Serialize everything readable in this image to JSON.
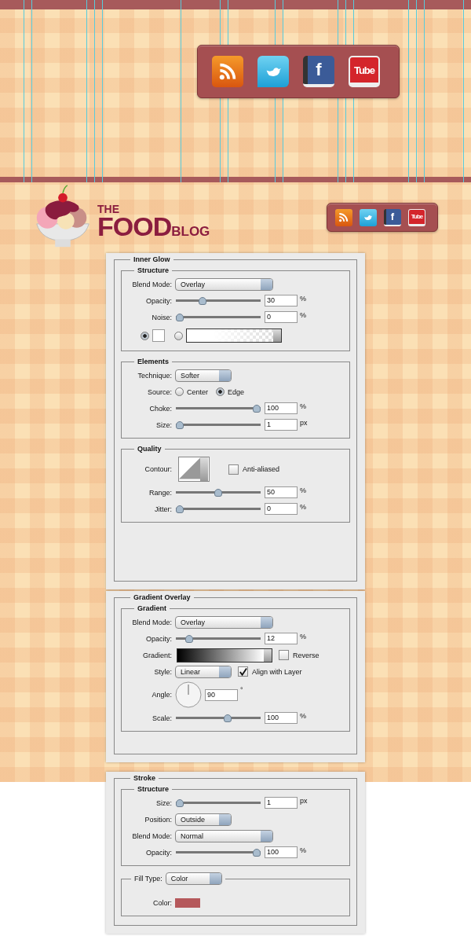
{
  "social_large": [
    {
      "kind": "rss"
    },
    {
      "kind": "twitter"
    },
    {
      "kind": "facebook",
      "label": "f"
    },
    {
      "kind": "youtube",
      "label": "Tube"
    }
  ],
  "logo": {
    "the": "THE",
    "food": "FOOD",
    "blog": "BLOG"
  },
  "social_small": [
    {
      "kind": "rss"
    },
    {
      "kind": "twitter"
    },
    {
      "kind": "facebook",
      "label": "f"
    },
    {
      "kind": "youtube",
      "label": "Tube"
    }
  ],
  "panels": [
    {
      "title": "Inner Glow",
      "groups": [
        {
          "title": "Structure",
          "rows": [
            {
              "kind": "select",
              "label": "Blend Mode:",
              "value": "Overlay"
            },
            {
              "kind": "slider",
              "label": "Opacity:",
              "level": 0.3,
              "value": "30",
              "unit": "%"
            },
            {
              "kind": "slider",
              "label": "Noise:",
              "level": 0,
              "value": "0",
              "unit": "%"
            },
            {
              "kind": "fill_choice",
              "options": [
                {
                  "selected": true
                },
                {
                  "selected": false
                }
              ]
            }
          ]
        },
        {
          "title": "Elements",
          "rows": [
            {
              "kind": "popup",
              "label": "Technique:",
              "value": "Softer"
            },
            {
              "kind": "radio",
              "label": "Source:",
              "options": [
                {
                  "label": "Center",
                  "selected": false
                },
                {
                  "label": "Edge",
                  "selected": true
                }
              ]
            },
            {
              "kind": "slider",
              "label": "Choke:",
              "level": 1,
              "value": "100",
              "unit": "%"
            },
            {
              "kind": "slider",
              "label": "Size:",
              "level": 0,
              "value": "1",
              "unit": "px"
            }
          ]
        },
        {
          "title": "Quality",
          "rows": [
            {
              "kind": "contour",
              "label": "Contour:",
              "check_label": "Anti-aliased",
              "checked": false
            },
            {
              "kind": "slider",
              "label": "Range:",
              "level": 0.5,
              "value": "50",
              "unit": "%"
            },
            {
              "kind": "slider",
              "label": "Jitter:",
              "level": 0,
              "value": "0",
              "unit": "%"
            }
          ]
        }
      ]
    },
    {
      "title": "Gradient Overlay",
      "groups": [
        {
          "title": "Gradient",
          "rows": [
            {
              "kind": "select",
              "label": "Blend Mode:",
              "value": "Overlay"
            },
            {
              "kind": "slider",
              "label": "Opacity:",
              "level": 0.12,
              "value": "12",
              "unit": "%"
            },
            {
              "kind": "gradient",
              "label": "Gradient:",
              "check_label": "Reverse",
              "checked": false
            },
            {
              "kind": "popup_check",
              "label": "Style:",
              "value": "Linear",
              "check_label": "Align with Layer",
              "checked": true
            },
            {
              "kind": "angle",
              "label": "Angle:",
              "value": "90",
              "unit": "°"
            },
            {
              "kind": "slider",
              "label": "Scale:",
              "level": 0.62,
              "value": "100",
              "unit": "%"
            }
          ]
        }
      ]
    },
    {
      "title": "Stroke",
      "groups": [
        {
          "title": "Structure",
          "rows": [
            {
              "kind": "slider",
              "label": "Size:",
              "level": 0,
              "value": "1",
              "unit": "px"
            },
            {
              "kind": "popup",
              "label": "Position:",
              "value": "Outside"
            },
            {
              "kind": "select",
              "label": "Blend Mode:",
              "value": "Normal"
            },
            {
              "kind": "slider",
              "label": "Opacity:",
              "level": 1,
              "value": "100",
              "unit": "%"
            }
          ]
        },
        {
          "legend_select": {
            "label": "Fill Type:",
            "value": "Color"
          },
          "rows": [
            {
              "kind": "color",
              "label": "Color:",
              "color": "#b5585b"
            }
          ]
        }
      ]
    }
  ]
}
